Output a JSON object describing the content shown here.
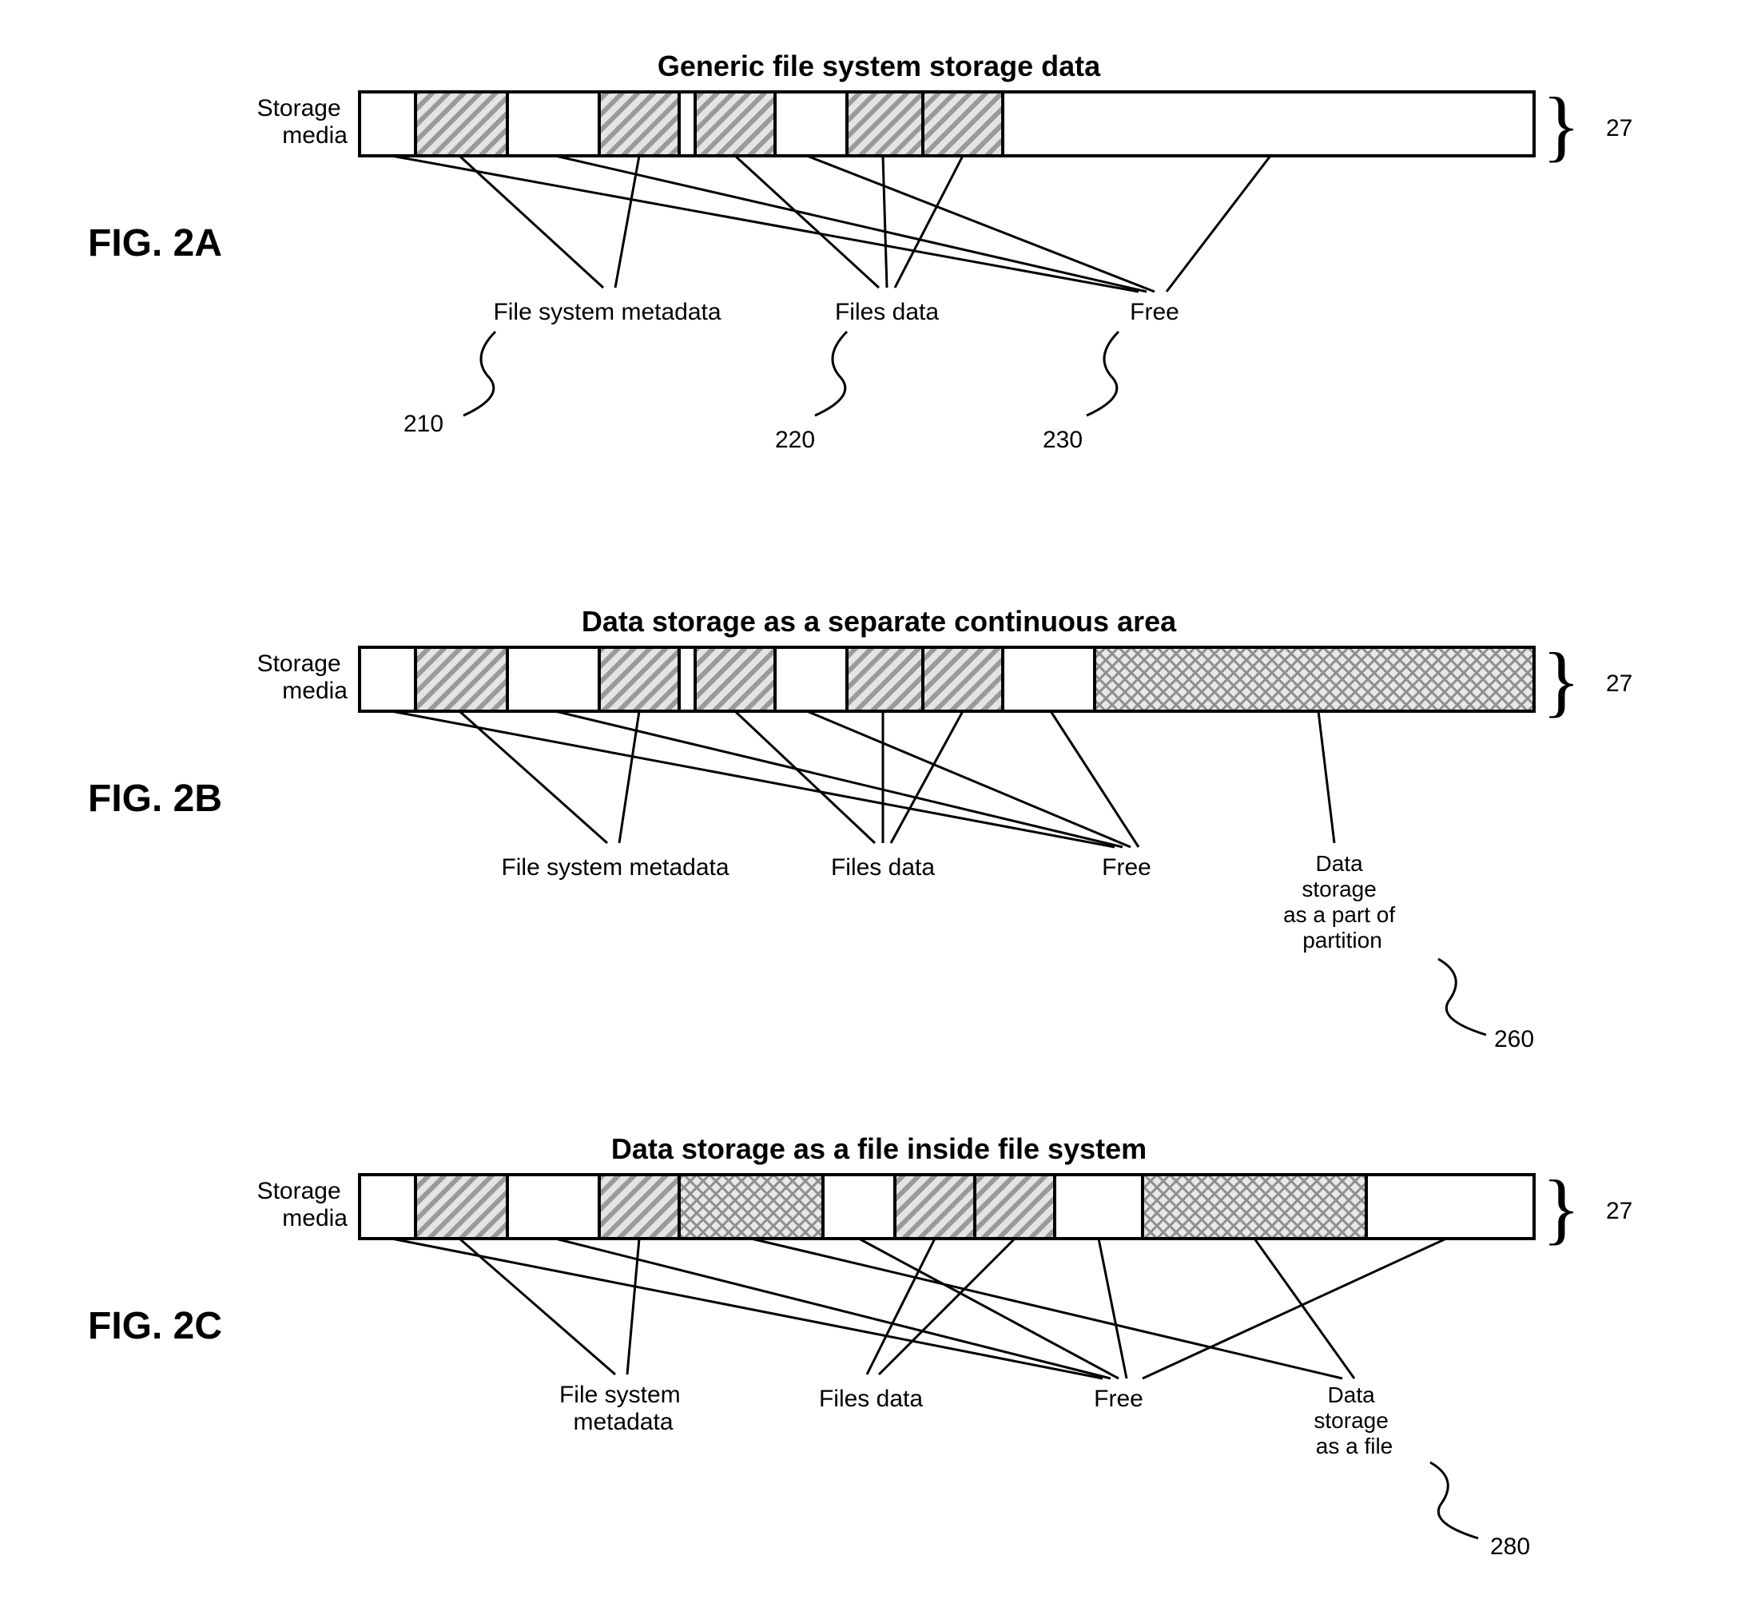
{
  "figA": {
    "title": "Generic file system storage data",
    "storage_media": "Storage\nmedia",
    "fig_label": "FIG. 2A",
    "ref_right": "27",
    "labels": {
      "metadata": "File system metadata",
      "files": "Files data",
      "free": "Free"
    },
    "refs": {
      "metadata": "210",
      "files": "220",
      "free": "230"
    }
  },
  "figB": {
    "title": "Data storage as a separate continuous area",
    "storage_media": "Storage\nmedia",
    "fig_label": "FIG. 2B",
    "ref_right": "27",
    "labels": {
      "metadata": "File system metadata",
      "files": "Files data",
      "free": "Free",
      "storage": "Data\nstorage\nas a part of\npartition"
    },
    "refs": {
      "storage": "260"
    }
  },
  "figC": {
    "title": "Data storage as a file inside file system",
    "storage_media": "Storage\nmedia",
    "fig_label": "FIG. 2C",
    "ref_right": "27",
    "labels": {
      "metadata": "File system\nmetadata",
      "files": "Files data",
      "free": "Free",
      "storage": "Data\nstorage\nas a file"
    },
    "refs": {
      "storage": "280"
    }
  }
}
